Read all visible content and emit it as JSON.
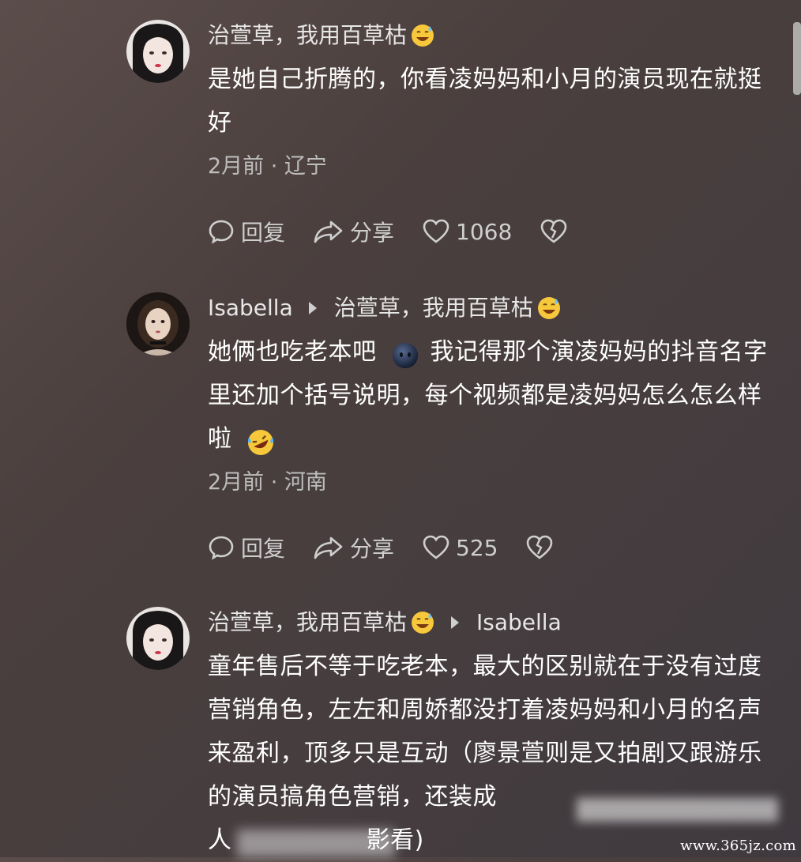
{
  "comments": [
    {
      "author": "治萱草，我用百草枯",
      "author_emoji": "sweat-smile-emoji",
      "text": "是她自己折腾的，你看凌妈妈和小月的演员现在就挺好",
      "meta": "2月前 · 辽宁",
      "reply_label": "回复",
      "share_label": "分享",
      "likes": "1068"
    },
    {
      "author": "Isabella",
      "reply_to": "治萱草，我用百草枯",
      "reply_to_emoji": "sweat-smile-emoji",
      "text_part1": "她俩也吃老本吧",
      "inline_emoji": "dark-face-emoji",
      "text_part2": "我记得那个演凌妈妈的抖音名字里还加个括号说明，每个视频都是凌妈妈怎么怎么样啦",
      "trailing_emoji": "rolling-laugh-emoji",
      "meta": "2月前 · 河南",
      "reply_label": "回复",
      "share_label": "分享",
      "likes": "525"
    },
    {
      "author": "治萱草，我用百草枯",
      "author_emoji": "sweat-smile-emoji",
      "reply_to": "Isabella",
      "text": "童年售后不等于吃老本，最大的区别就在于没有过度营销角色，左左和周娇都没打着凌妈妈和小月的名声来盈利，顶多只是互动（廖景萱则是又拍剧又跟游乐的演员搞角色营销，还装成",
      "text_tail": "人",
      "text_tail2": "影看)"
    }
  ],
  "watermark": "www.365jz.com"
}
